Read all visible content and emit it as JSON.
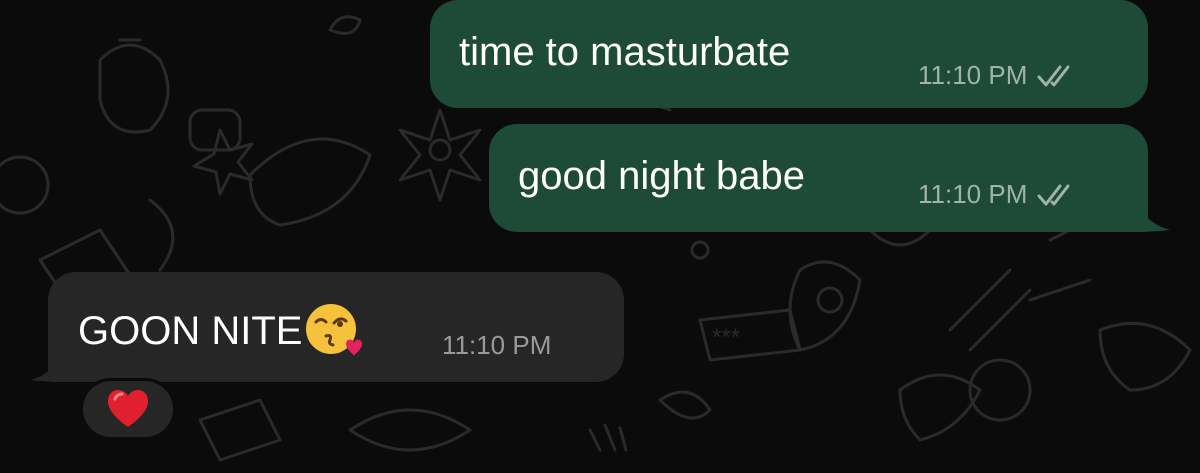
{
  "messages": [
    {
      "direction": "outgoing",
      "text": "time to masturbate",
      "time": "11:10 PM",
      "status": "read-double-check"
    },
    {
      "direction": "outgoing",
      "text": "good night babe",
      "time": "11:10 PM",
      "status": "read-double-check"
    },
    {
      "direction": "incoming",
      "text": "GOON NITE",
      "emoji": "face-blowing-a-kiss",
      "time": "11:10 PM",
      "reaction": "red-heart"
    }
  ],
  "colors": {
    "background": "#0b0b0b",
    "outgoing_bubble": "#1e4b37",
    "incoming_bubble": "#262626",
    "text": "#ffffff",
    "meta_text": "#9fb3a8"
  },
  "icons": [
    "double-check-icon",
    "kiss-face-emoji",
    "red-heart-icon"
  ]
}
